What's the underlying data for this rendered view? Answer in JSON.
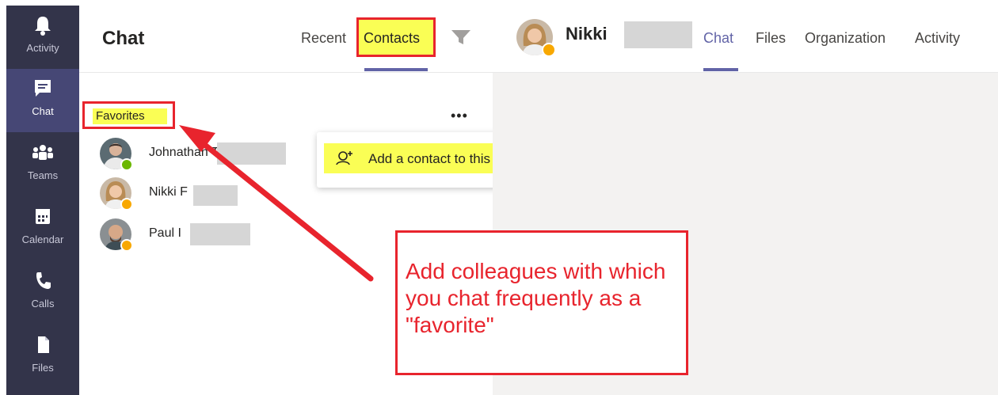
{
  "rail": {
    "items": [
      {
        "label": "Activity",
        "icon": "bell-icon"
      },
      {
        "label": "Chat",
        "icon": "chat-icon"
      },
      {
        "label": "Teams",
        "icon": "teams-icon"
      },
      {
        "label": "Calendar",
        "icon": "calendar-icon"
      },
      {
        "label": "Calls",
        "icon": "phone-icon"
      },
      {
        "label": "Files",
        "icon": "file-icon"
      }
    ],
    "active": "Chat"
  },
  "list": {
    "title": "Chat",
    "tabs": {
      "recent": "Recent",
      "contacts": "Contacts"
    },
    "group_label": "Favorites",
    "more_label": "•••",
    "contacts": [
      {
        "name": "Johnathan T",
        "status": "available"
      },
      {
        "name": "Nikki F",
        "status": "away"
      },
      {
        "name": "Paul I",
        "status": "away"
      }
    ]
  },
  "popup": {
    "item_label": "Add a contact to this group"
  },
  "conversation": {
    "name": "Nikki",
    "tabs": [
      "Chat",
      "Files",
      "Organization",
      "Activity"
    ],
    "active_tab": "Chat"
  },
  "annotation": {
    "text": "Add colleagues with which you chat frequently as a \"favorite\""
  },
  "colors": {
    "rail": "#33344a",
    "accent": "#6264a7",
    "highlight": "#fafe55",
    "annotation": "#e8242d",
    "available": "#6bb700",
    "away": "#f8a800"
  }
}
